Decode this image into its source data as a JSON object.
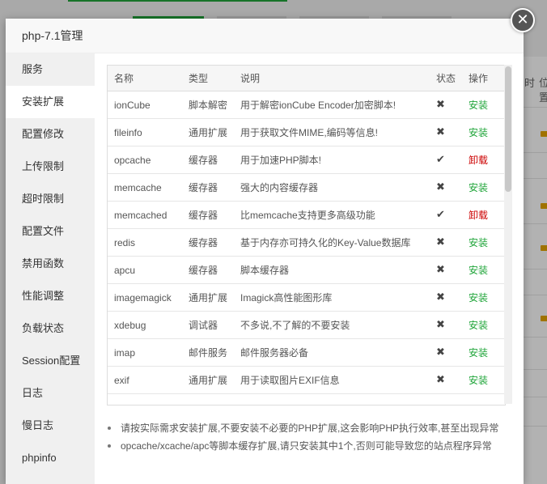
{
  "background": {
    "right_headers": [
      "时",
      "位置"
    ]
  },
  "modal": {
    "title": "php-7.1管理",
    "close_icon": "✕"
  },
  "sidebar": {
    "items": [
      {
        "label": "服务"
      },
      {
        "label": "安装扩展",
        "active": true
      },
      {
        "label": "配置修改"
      },
      {
        "label": "上传限制"
      },
      {
        "label": "超时限制"
      },
      {
        "label": "配置文件"
      },
      {
        "label": "禁用函数"
      },
      {
        "label": "性能调整"
      },
      {
        "label": "负载状态"
      },
      {
        "label": "Session配置"
      },
      {
        "label": "日志"
      },
      {
        "label": "慢日志"
      },
      {
        "label": "phpinfo"
      }
    ]
  },
  "table": {
    "headers": [
      "名称",
      "类型",
      "说明",
      "状态",
      "操作"
    ],
    "rows": [
      {
        "name": "ionCube",
        "type": "脚本解密",
        "desc": "用于解密ionCube Encoder加密脚本!",
        "status": "✖",
        "action": "安装"
      },
      {
        "name": "fileinfo",
        "type": "通用扩展",
        "desc": "用于获取文件MIME,编码等信息!",
        "status": "✖",
        "action": "安装"
      },
      {
        "name": "opcache",
        "type": "缓存器",
        "desc": "用于加速PHP脚本!",
        "status": "✔",
        "action": "卸载"
      },
      {
        "name": "memcache",
        "type": "缓存器",
        "desc": "强大的内容缓存器",
        "status": "✖",
        "action": "安装"
      },
      {
        "name": "memcached",
        "type": "缓存器",
        "desc": "比memcache支持更多高级功能",
        "status": "✔",
        "action": "卸载"
      },
      {
        "name": "redis",
        "type": "缓存器",
        "desc": "基于内存亦可持久化的Key-Value数据库",
        "status": "✖",
        "action": "安装"
      },
      {
        "name": "apcu",
        "type": "缓存器",
        "desc": "脚本缓存器",
        "status": "✖",
        "action": "安装"
      },
      {
        "name": "imagemagick",
        "type": "通用扩展",
        "desc": "Imagick高性能图形库",
        "status": "✖",
        "action": "安装"
      },
      {
        "name": "xdebug",
        "type": "调试器",
        "desc": "不多说,不了解的不要安装",
        "status": "✖",
        "action": "安装"
      },
      {
        "name": "imap",
        "type": "邮件服务",
        "desc": "邮件服务器必备",
        "status": "✖",
        "action": "安装"
      },
      {
        "name": "exif",
        "type": "通用扩展",
        "desc": "用于读取图片EXIF信息",
        "status": "✖",
        "action": "安装"
      }
    ]
  },
  "tips": [
    "请按实际需求安装扩展,不要安装不必要的PHP扩展,这会影响PHP执行效率,甚至出现异常",
    "opcache/xcache/apc等脚本缓存扩展,请只安装其中1个,否则可能导致您的站点程序异常"
  ]
}
